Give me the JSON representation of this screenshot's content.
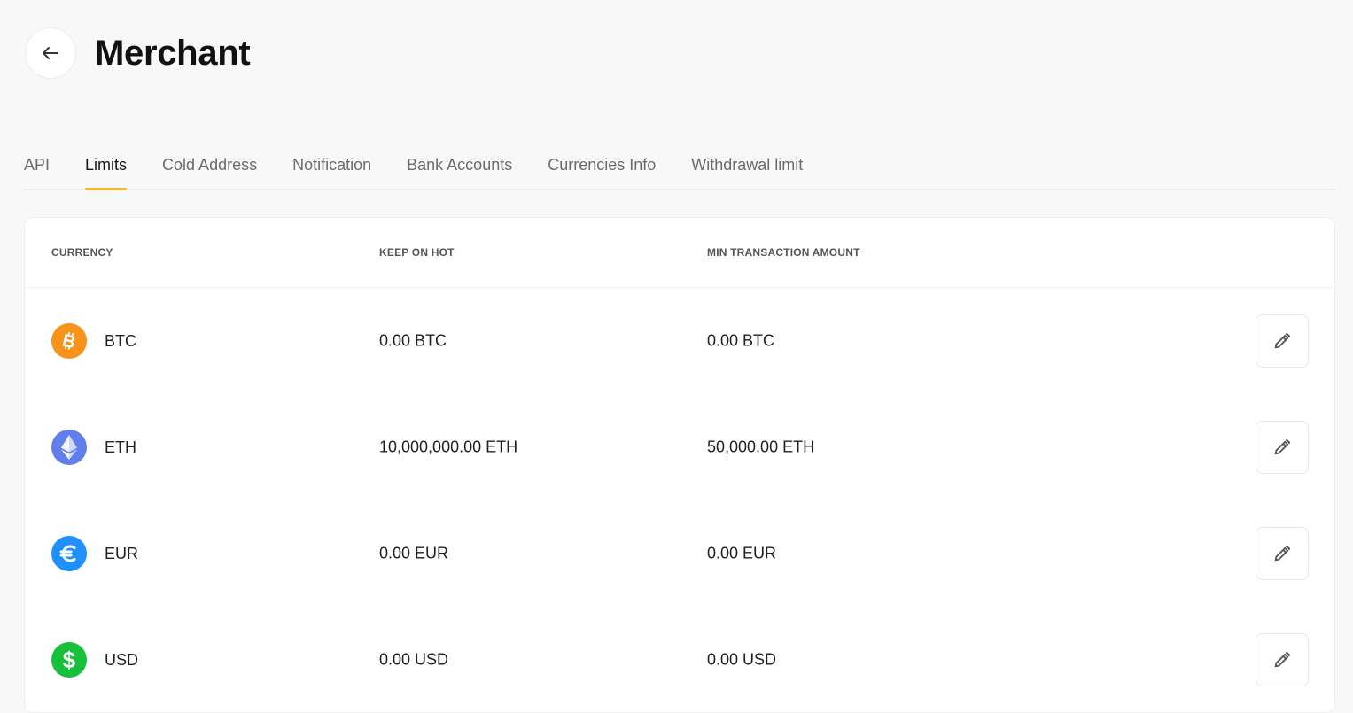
{
  "header": {
    "title": "Merchant",
    "back_icon": "arrow-left-icon"
  },
  "tabs": [
    {
      "label": "API",
      "active": false
    },
    {
      "label": "Limits",
      "active": true
    },
    {
      "label": "Cold Address",
      "active": false
    },
    {
      "label": "Notification",
      "active": false
    },
    {
      "label": "Bank Accounts",
      "active": false
    },
    {
      "label": "Currencies Info",
      "active": false
    },
    {
      "label": "Withdrawal limit",
      "active": false
    }
  ],
  "colors": {
    "accent": "#f5b731",
    "btc": "#f7931a",
    "eth": "#627eea",
    "eur": "#1e90ff",
    "usd": "#17c03b"
  },
  "table": {
    "columns": [
      "CURRENCY",
      "KEEP ON HOT",
      "MIN TRANSACTION AMOUNT"
    ],
    "rows": [
      {
        "currency": "BTC",
        "icon": "bitcoin-icon",
        "keep_on_hot": "0.00 BTC",
        "min_transaction": "0.00 BTC"
      },
      {
        "currency": "ETH",
        "icon": "ethereum-icon",
        "keep_on_hot": "10,000,000.00 ETH",
        "min_transaction": "50,000.00 ETH"
      },
      {
        "currency": "EUR",
        "icon": "euro-icon",
        "keep_on_hot": "0.00 EUR",
        "min_transaction": "0.00 EUR"
      },
      {
        "currency": "USD",
        "icon": "dollar-icon",
        "keep_on_hot": "0.00 USD",
        "min_transaction": "0.00 USD"
      }
    ],
    "edit_icon": "pencil-icon"
  }
}
